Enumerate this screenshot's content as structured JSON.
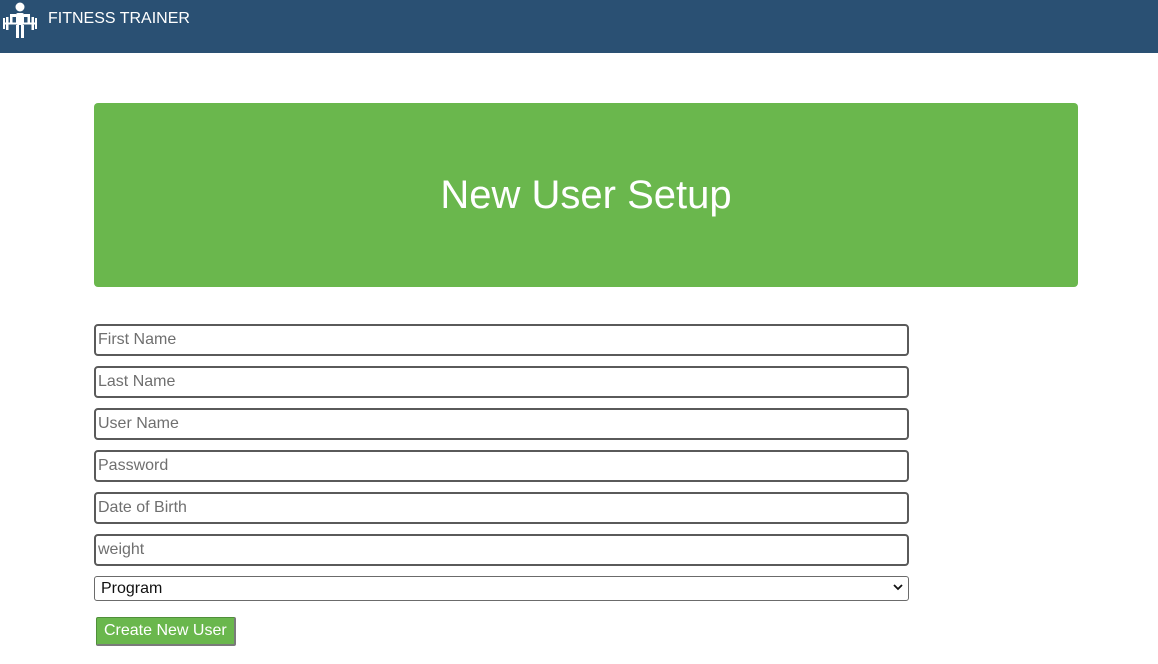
{
  "navbar": {
    "brand_icon": "weightlifter-icon",
    "brand_text": "FITNESS TRAINER"
  },
  "hero": {
    "title": "New User Setup"
  },
  "form": {
    "first_name_placeholder": "First Name",
    "last_name_placeholder": "Last Name",
    "user_name_placeholder": "User Name",
    "password_placeholder": "Password",
    "dob_placeholder": "Date of Birth",
    "weight_placeholder": "weight",
    "program_selected": "Program",
    "submit_label": "Create New User"
  },
  "colors": {
    "navbar": "#2a5073",
    "accent_green": "#6ab74d"
  }
}
